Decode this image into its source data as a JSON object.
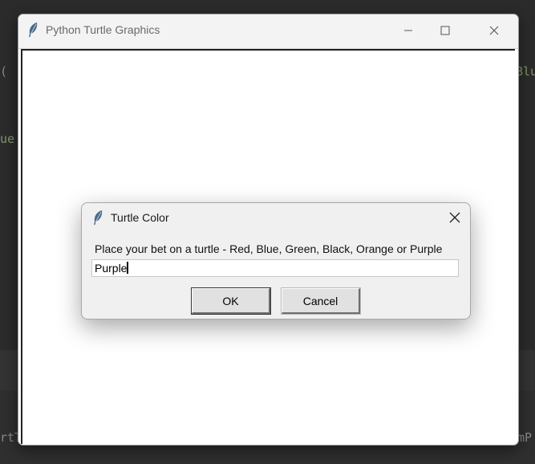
{
  "background": {
    "fragments": [
      {
        "text": "( ",
        "pos": "left-top"
      },
      {
        "text": "Blu",
        "pos": "right-top"
      },
      {
        "text": "ue",
        "pos": "left-mid"
      },
      {
        "text": "rtT",
        "pos": "left-bottom"
      },
      {
        "text": "mP",
        "pos": "right-bottom"
      }
    ]
  },
  "main_window": {
    "title": "Python Turtle Graphics",
    "icon": "feather-icon",
    "controls": [
      "minimize-icon",
      "maximize-icon",
      "close-icon"
    ]
  },
  "dialog": {
    "title": "Turtle Color",
    "icon": "feather-icon",
    "prompt": "Place your bet on a turtle - Red, Blue, Green, Black, Orange or Purple",
    "input_value": "Purple",
    "ok_label": "OK",
    "cancel_label": "Cancel"
  },
  "colors": {
    "window_bg": "#ffffff",
    "dialog_bg": "#f0f0f0",
    "editor_bg": "#2b2b2b",
    "button_bg": "#e1e1e1"
  }
}
